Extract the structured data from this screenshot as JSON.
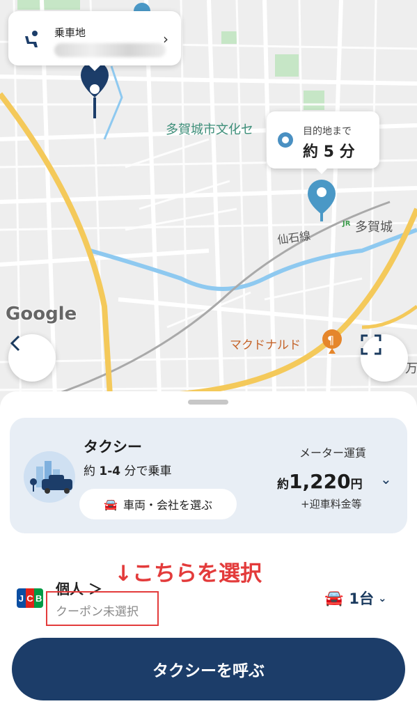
{
  "pickup": {
    "label": "乗車地",
    "address_blurred": ""
  },
  "destination_eta": {
    "line1": "目的地まで",
    "line2": "約 5 分"
  },
  "map_labels": {
    "culture_center": "多賀城市文化セ",
    "station": "多賀城",
    "station_badge": "JR",
    "line": "仙石線",
    "mcdonalds": "マクドナルド",
    "edge": "万"
  },
  "google_logo": "Google",
  "taxi": {
    "name": "タクシー",
    "eta_prefix": "約",
    "eta_value": "1-4",
    "eta_suffix": "分で乗車",
    "choose_button": "車両・会社を選ぶ",
    "fare_label": "メーター運賃",
    "fare_prefix": "約",
    "fare_amount": "1,220",
    "fare_unit": "円",
    "fare_extra": "+迎車料金等"
  },
  "annotation": "↓こちらを選択",
  "payment": {
    "brand": "JCB",
    "label": "個人 ＞",
    "coupon": "クーポン未選択"
  },
  "car_count": "1台",
  "call_button": "タクシーを呼ぶ",
  "colors": {
    "navy": "#1c3d69",
    "annotation_red": "#e33b3b",
    "card_bg": "#e8eef5"
  }
}
